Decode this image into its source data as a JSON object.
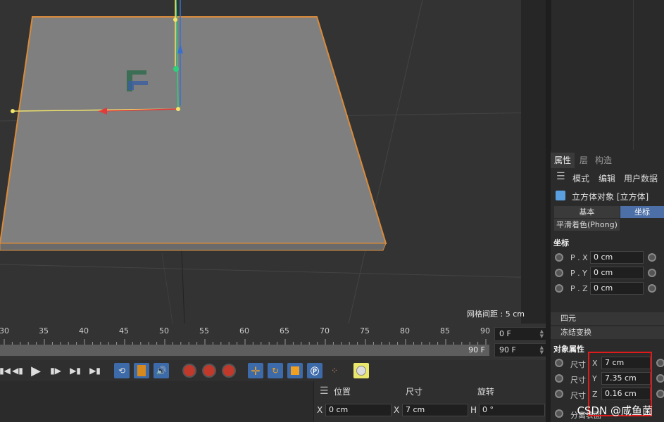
{
  "viewport": {
    "grid_spacing": "网格间距 : 5 cm"
  },
  "timeline": {
    "ruler": [
      "30",
      "35",
      "40",
      "45",
      "50",
      "55",
      "60",
      "65",
      "70",
      "75",
      "80",
      "85",
      "90"
    ],
    "range_end": "90 F",
    "current_frame": "0 F",
    "end_frame": "90 F"
  },
  "coord": {
    "headers": [
      "位置",
      "尺寸",
      "旋转"
    ],
    "row": {
      "x_label": "X",
      "x_val": "0 cm",
      "sx_label": "X",
      "sx_val": "7 cm",
      "h_label": "H",
      "h_val": "0 °"
    }
  },
  "attributes": {
    "tabs": [
      "属性",
      "层",
      "构造"
    ],
    "menu": [
      "模式",
      "编辑",
      "用户数据"
    ],
    "object_title": "立方体对象 [立方体]",
    "subtabs": [
      "基本",
      "坐标"
    ],
    "phong": "平滑着色(Phong)",
    "coord_section": "坐标",
    "coords": [
      {
        "label": "P . X",
        "value": "0 cm"
      },
      {
        "label": "P . Y",
        "value": "0 cm"
      },
      {
        "label": "P . Z",
        "value": "0 cm"
      }
    ],
    "fold_quat": "四元",
    "fold_freeze": "冻结变换",
    "obj_section": "对象属性",
    "size_label": "尺寸",
    "sizes": [
      {
        "axis": "X",
        "value": "7 cm"
      },
      {
        "axis": "Y",
        "value": "7.35 cm"
      },
      {
        "axis": "Z",
        "value": "0.16 cm"
      }
    ],
    "split_label": "分离表面"
  },
  "watermark": "CSDN @咸鱼菌",
  "colors": {
    "accent": "#3d6aa8",
    "highlight": "#e01a1a",
    "plane": "#7f7f7f",
    "outline": "#d98b3a"
  }
}
